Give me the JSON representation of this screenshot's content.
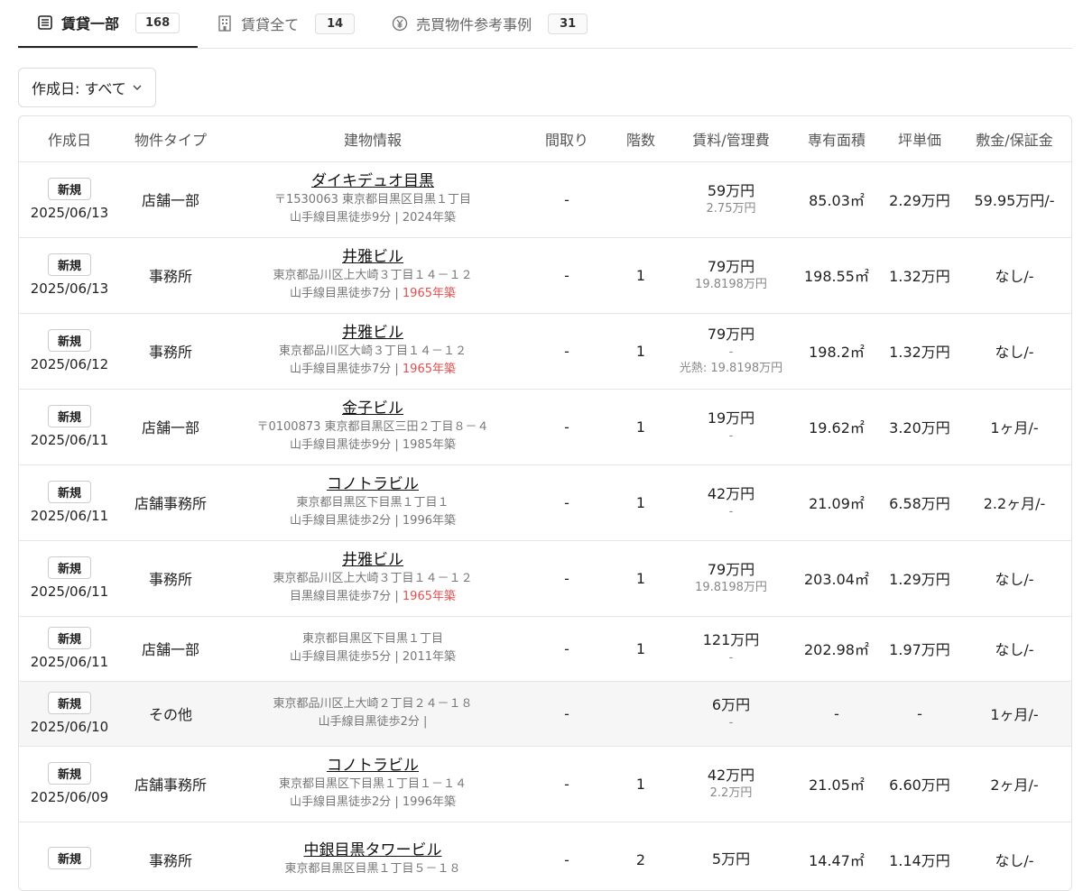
{
  "tabs": [
    {
      "label": "賃貸一部",
      "count": "168",
      "icon": "building-icon"
    },
    {
      "label": "賃貸全て",
      "count": "14",
      "icon": "office-icon"
    },
    {
      "label": "売買物件参考事例",
      "count": "31",
      "icon": "yen-icon"
    }
  ],
  "filter": {
    "label": "作成日: すべて"
  },
  "columns": [
    "作成日",
    "物件タイプ",
    "建物情報",
    "間取り",
    "階数",
    "賃料/管理費",
    "専有面積",
    "坪単価",
    "敷金/保証金"
  ],
  "badge": "新規",
  "rows": [
    {
      "date": "2025/06/13",
      "type": "店舗一部",
      "name": "ダイキデュオ目黒",
      "addr": "〒1530063 東京都目黒区目黒１丁目",
      "access": "山手線目黒徒歩9分 | ",
      "year": "2024年築",
      "old": false,
      "layout": "-",
      "floor": "",
      "rent": "59万円",
      "fee": "2.75万円",
      "extra": "",
      "area": "85.03㎡",
      "tsubo": "2.29万円",
      "deposit": "59.95万円/-"
    },
    {
      "date": "2025/06/13",
      "type": "事務所",
      "name": "井雅ビル",
      "addr": "東京都品川区上大崎３丁目１４－１２",
      "access": "山手線目黒徒歩7分 | ",
      "year": "1965年築",
      "old": true,
      "layout": "-",
      "floor": "1",
      "rent": "79万円",
      "fee": "19.8198万円",
      "extra": "",
      "area": "198.55㎡",
      "tsubo": "1.32万円",
      "deposit": "なし/-"
    },
    {
      "date": "2025/06/12",
      "type": "事務所",
      "name": "井雅ビル",
      "addr": "東京都品川区大崎３丁目１４－１２",
      "access": "山手線目黒徒歩7分 | ",
      "year": "1965年築",
      "old": true,
      "layout": "-",
      "floor": "1",
      "rent": "79万円",
      "fee": "-",
      "extra": "光熱: 19.8198万円",
      "area": "198.2㎡",
      "tsubo": "1.32万円",
      "deposit": "なし/-"
    },
    {
      "date": "2025/06/11",
      "type": "店舗一部",
      "name": "金子ビル",
      "addr": "〒0100873 東京都目黒区三田２丁目８－４",
      "access": "山手線目黒徒歩9分 | ",
      "year": "1985年築",
      "old": false,
      "layout": "-",
      "floor": "1",
      "rent": "19万円",
      "fee": "-",
      "extra": "",
      "area": "19.62㎡",
      "tsubo": "3.20万円",
      "deposit": "1ヶ月/-"
    },
    {
      "date": "2025/06/11",
      "type": "店舗事務所",
      "name": "コノトラビル",
      "addr": "東京都目黒区下目黒１丁目１",
      "access": "山手線目黒徒歩2分 | ",
      "year": "1996年築",
      "old": false,
      "layout": "-",
      "floor": "1",
      "rent": "42万円",
      "fee": "-",
      "extra": "",
      "area": "21.09㎡",
      "tsubo": "6.58万円",
      "deposit": "2.2ヶ月/-"
    },
    {
      "date": "2025/06/11",
      "type": "事務所",
      "name": "井雅ビル",
      "addr": "東京都品川区上大崎３丁目１４－１２",
      "access": "目黒線目黒徒歩7分 | ",
      "year": "1965年築",
      "old": true,
      "layout": "-",
      "floor": "1",
      "rent": "79万円",
      "fee": "19.8198万円",
      "extra": "",
      "area": "203.04㎡",
      "tsubo": "1.29万円",
      "deposit": "なし/-"
    },
    {
      "date": "2025/06/11",
      "type": "店舗一部",
      "name": "",
      "addr": "東京都目黒区下目黒１丁目",
      "access": "山手線目黒徒歩5分 | ",
      "year": "2011年築",
      "old": false,
      "layout": "-",
      "floor": "1",
      "rent": "121万円",
      "fee": "-",
      "extra": "",
      "area": "202.98㎡",
      "tsubo": "1.97万円",
      "deposit": "なし/-"
    },
    {
      "date": "2025/06/10",
      "type": "その他",
      "name": "",
      "addr": "東京都品川区上大崎２丁目２４－１８",
      "access": "山手線目黒徒歩2分 | ",
      "year": "",
      "old": false,
      "layout": "-",
      "floor": "",
      "rent": "6万円",
      "fee": "-",
      "extra": "",
      "area": "-",
      "tsubo": "-",
      "deposit": "1ヶ月/-"
    },
    {
      "date": "2025/06/09",
      "type": "店舗事務所",
      "name": "コノトラビル",
      "addr": "東京都目黒区下目黒１丁目１－１４",
      "access": "山手線目黒徒歩2分 | ",
      "year": "1996年築",
      "old": false,
      "layout": "-",
      "floor": "1",
      "rent": "42万円",
      "fee": "2.2万円",
      "extra": "",
      "area": "21.05㎡",
      "tsubo": "6.60万円",
      "deposit": "2ヶ月/-"
    },
    {
      "date": "",
      "type": "事務所",
      "name": "中銀目黒タワービル",
      "addr": "東京都目黒区目黒１丁目５－１８",
      "access": "",
      "year": "",
      "old": false,
      "layout": "-",
      "floor": "2",
      "rent": "5万円",
      "fee": "",
      "extra": "",
      "area": "14.47㎡",
      "tsubo": "1.14万円",
      "deposit": "なし/-"
    }
  ]
}
